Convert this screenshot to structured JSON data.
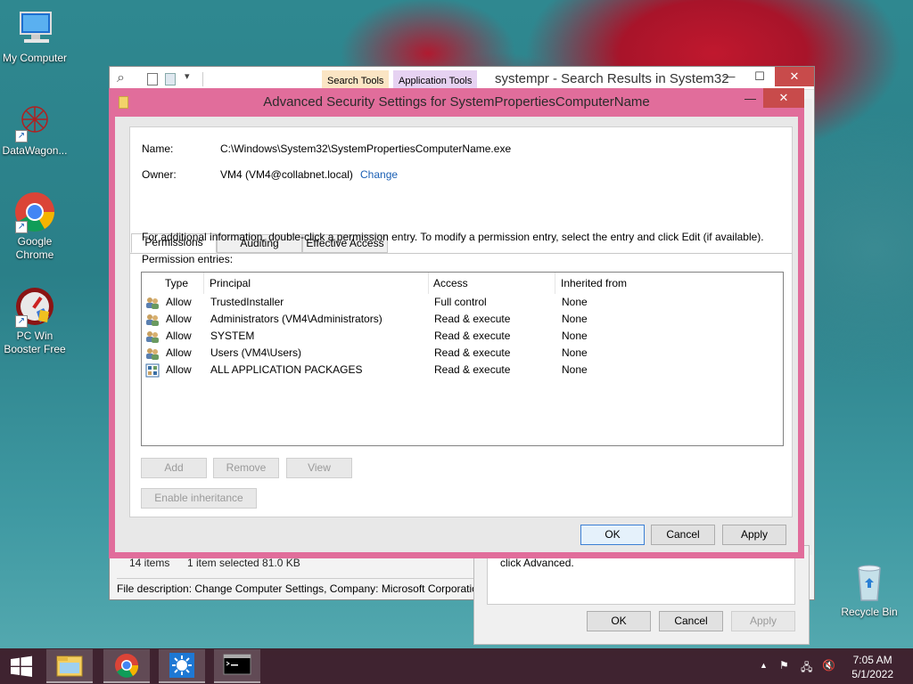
{
  "desktop": {
    "icons": [
      {
        "label": "My Computer"
      },
      {
        "label": "DataWagon..."
      },
      {
        "label": "Google Chrome"
      },
      {
        "label": "PC Win Booster Free"
      },
      {
        "label": "Recycle Bin"
      }
    ]
  },
  "explorer": {
    "context_tabs": [
      "Search Tools",
      "Application Tools"
    ],
    "title": "systempr - Search Results in System32",
    "status_items": "14 items",
    "status_selected": "1 item selected  81.0 KB",
    "file_description": "File description: Change Computer Settings, Company: Microsoft Corporation"
  },
  "properties_dialog": {
    "partial_text": "click Advanced.",
    "ok": "OK",
    "cancel": "Cancel",
    "apply": "Apply"
  },
  "advanced": {
    "title": "Advanced Security Settings for SystemPropertiesComputerName",
    "name_label": "Name:",
    "name_value": "C:\\Windows\\System32\\SystemPropertiesComputerName.exe",
    "owner_label": "Owner:",
    "owner_value": "VM4 (VM4@collabnet.local)",
    "change_link": "Change",
    "tabs": [
      "Permissions",
      "Auditing",
      "Effective Access"
    ],
    "info_text": "For additional information, double-click a permission entry. To modify a permission entry, select the entry and click Edit (if available).",
    "entries_label": "Permission entries:",
    "columns": [
      "Type",
      "Principal",
      "Access",
      "Inherited from"
    ],
    "rows": [
      {
        "type": "Allow",
        "principal": "TrustedInstaller",
        "access": "Full control",
        "inherited": "None",
        "icon": "users-icon"
      },
      {
        "type": "Allow",
        "principal": "Administrators (VM4\\Administrators)",
        "access": "Read & execute",
        "inherited": "None",
        "icon": "users-icon"
      },
      {
        "type": "Allow",
        "principal": "SYSTEM",
        "access": "Read & execute",
        "inherited": "None",
        "icon": "users-icon"
      },
      {
        "type": "Allow",
        "principal": "Users (VM4\\Users)",
        "access": "Read & execute",
        "inherited": "None",
        "icon": "users-icon"
      },
      {
        "type": "Allow",
        "principal": "ALL APPLICATION PACKAGES",
        "access": "Read & execute",
        "inherited": "None",
        "icon": "app-packages-icon"
      }
    ],
    "buttons": {
      "add": "Add",
      "remove": "Remove",
      "view": "View",
      "enable_inheritance": "Enable inheritance",
      "ok": "OK",
      "cancel": "Cancel",
      "apply": "Apply"
    },
    "accent_color": "#e16d9b"
  },
  "taskbar": {
    "apps": [
      "file-explorer-icon",
      "chrome-icon",
      "brightness-app-icon",
      "command-prompt-icon"
    ],
    "time": "7:05 AM",
    "date": "5/1/2022"
  }
}
